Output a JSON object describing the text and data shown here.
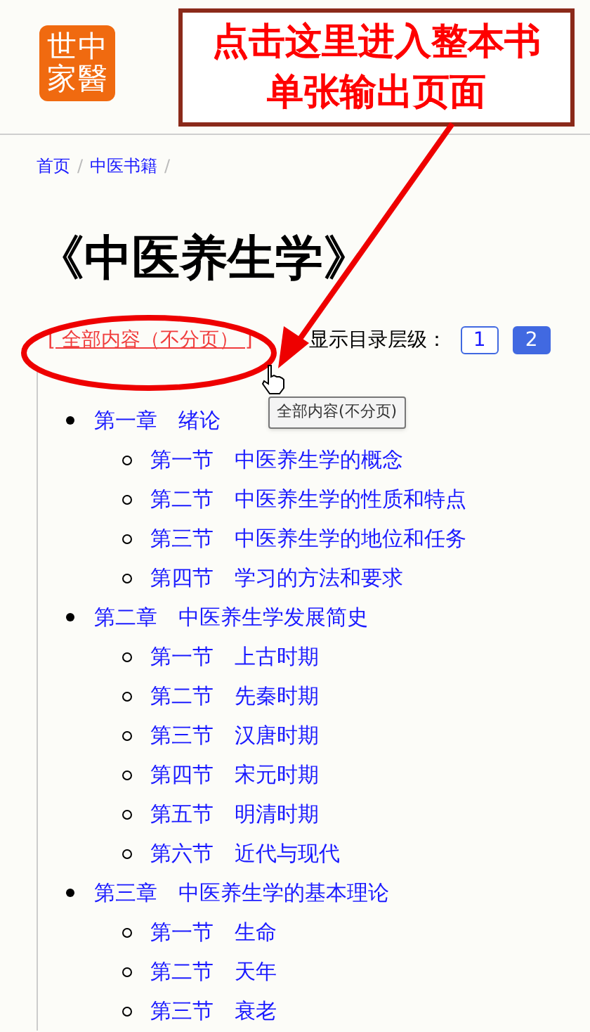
{
  "logo": {
    "columns": [
      "世家",
      "中醫"
    ]
  },
  "callout": {
    "text": "点击这里进入整本书单张输出页面"
  },
  "breadcrumb": [
    {
      "label": "首页",
      "separator": "/"
    },
    {
      "label": "中医书籍",
      "separator": "/"
    }
  ],
  "title": "《中医养生学》",
  "full_content_link": "[ 全部内容（不分页） ]",
  "tooltip": "全部内容(不分页)",
  "level_label": "显示目录层级：",
  "levels": [
    {
      "label": "1",
      "selected": false
    },
    {
      "label": "2",
      "selected": true
    }
  ],
  "toc": [
    {
      "label": "第一章　绪论",
      "children": [
        {
          "label": "第一节　中医养生学的概念"
        },
        {
          "label": "第二节　中医养生学的性质和特点"
        },
        {
          "label": "第三节　中医养生学的地位和任务"
        },
        {
          "label": "第四节　学习的方法和要求"
        }
      ]
    },
    {
      "label": "第二章　中医养生学发展简史",
      "children": [
        {
          "label": "第一节　上古时期"
        },
        {
          "label": "第二节　先秦时期"
        },
        {
          "label": "第三节　汉唐时期"
        },
        {
          "label": "第四节　宋元时期"
        },
        {
          "label": "第五节　明清时期"
        },
        {
          "label": "第六节　近代与现代"
        }
      ]
    },
    {
      "label": "第三章　中医养生学的基本理论",
      "children": [
        {
          "label": "第一节　生命"
        },
        {
          "label": "第二节　天年"
        },
        {
          "label": "第三节　衰老"
        }
      ]
    }
  ]
}
